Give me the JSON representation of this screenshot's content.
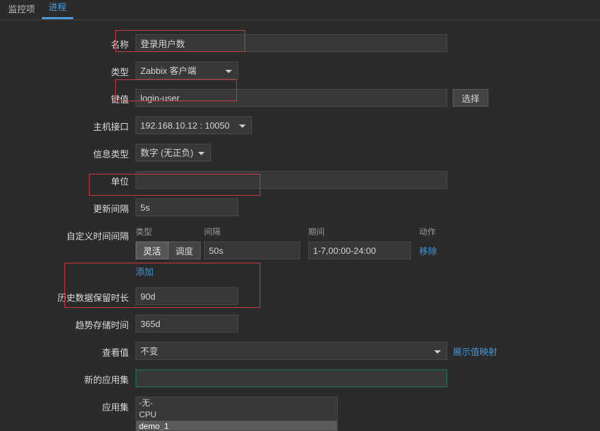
{
  "tabs": {
    "monitor": "监控项",
    "process": "进程"
  },
  "labels": {
    "name": "名称",
    "type": "类型",
    "key": "键值",
    "host_iface": "主机接口",
    "info_type": "信息类型",
    "unit": "单位",
    "update_int": "更新间隔",
    "custom_int": "自定义时间间隔",
    "hist_keep": "历史数据保留时长",
    "trend_keep": "趋势存储时间",
    "view_value": "查看值",
    "new_app": "新的应用集",
    "app_set": "应用集"
  },
  "fields": {
    "name": "登录用户数",
    "type": "Zabbix 客户端",
    "key": "login-user",
    "host_iface": "192.168.10.12 : 10050",
    "info_type": "数字 (无正负)",
    "unit": "",
    "update_int": "5s",
    "hist_keep": "90d",
    "trend_keep": "365d",
    "view_value": "不变",
    "new_app": ""
  },
  "buttons": {
    "select": "选择",
    "flex": "灵活",
    "schedule": "调度",
    "add": "添加",
    "remove": "移除",
    "show_map": "展示值映射"
  },
  "interval_head": {
    "type": "类型",
    "interval": "间隔",
    "period": "期间",
    "action": "动作"
  },
  "interval_row": {
    "interval": "50s",
    "period": "1-7,00:00-24:00"
  },
  "app_options": [
    "-无-",
    "CPU",
    "demo_1"
  ]
}
